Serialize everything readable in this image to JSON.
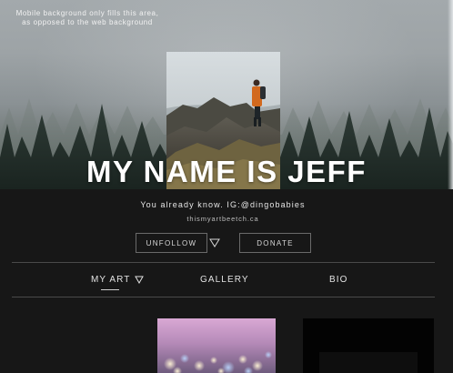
{
  "hero": {
    "mobile_note_line1": "Mobile background only fills this area,",
    "mobile_note_line2": "as opposed to the web background",
    "title": "MY NAME IS JEFF"
  },
  "profile": {
    "tagline": "You already know. IG:@dingobabies",
    "website": "thismyartbeetch.ca"
  },
  "actions": {
    "unfollow_label": "UNFOLLOW",
    "donate_label": "DONATE"
  },
  "nav": {
    "tabs": [
      {
        "label": "MY ART",
        "active": true
      },
      {
        "label": "GALLERY",
        "active": false
      },
      {
        "label": "BIO",
        "active": false
      }
    ]
  },
  "icons": {
    "follow_dropdown": "chevron-down-outline-icon",
    "tab_dropdown": "chevron-down-outline-icon"
  },
  "colors": {
    "page_background": "#171717",
    "text_primary": "#e6e6e6",
    "button_border": "#6a6a6a",
    "divider": "#4a4a4a"
  }
}
